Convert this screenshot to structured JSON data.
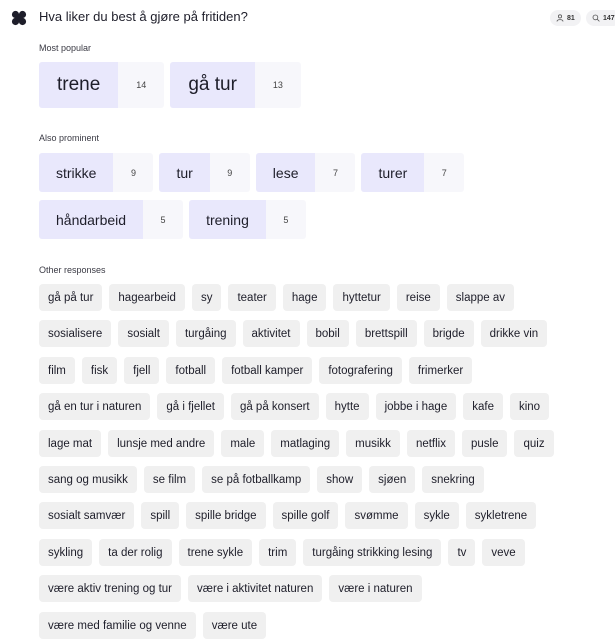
{
  "header": {
    "question": "Hva liker du best å gjøre på fritiden?",
    "participants_count": "81",
    "responses_count": "147"
  },
  "sections": {
    "most_popular": {
      "label": "Most popular",
      "items": [
        {
          "label": "trene",
          "count": "14"
        },
        {
          "label": "gå tur",
          "count": "13"
        }
      ]
    },
    "also_prominent": {
      "label": "Also prominent",
      "rows": [
        [
          {
            "label": "strikke",
            "count": "9"
          },
          {
            "label": "tur",
            "count": "9"
          },
          {
            "label": "lese",
            "count": "7"
          },
          {
            "label": "turer",
            "count": "7"
          }
        ],
        [
          {
            "label": "håndarbeid",
            "count": "5"
          },
          {
            "label": "trening",
            "count": "5"
          }
        ]
      ]
    },
    "other": {
      "label": "Other responses",
      "rows": [
        [
          "gå på tur",
          "hagearbeid",
          "sy",
          "teater",
          "hage",
          "hyttetur",
          "reise",
          "slappe av"
        ],
        [
          "sosialisere",
          "sosialt",
          "turgåing",
          "aktivitet",
          "bobil",
          "brettspill",
          "brigde",
          "drikke vin"
        ],
        [
          "film",
          "fisk",
          "fjell",
          "fotball",
          "fotball kamper",
          "fotografering",
          "frimerker"
        ],
        [
          "gå en tur i naturen",
          "gå i fjellet",
          "gå på konsert",
          "hytte",
          "jobbe i hage",
          "kafe",
          "kino"
        ],
        [
          "lage mat",
          "lunsje med andre",
          "male",
          "matlaging",
          "musikk",
          "netflix",
          "pusle",
          "quiz"
        ],
        [
          "sang og musikk",
          "se film",
          "se på fotballkamp",
          "show",
          "sjøen",
          "snekring"
        ],
        [
          "sosialt samvær",
          "spill",
          "spille bridge",
          "spille golf",
          "svømme",
          "sykle",
          "sykletrene"
        ],
        [
          "sykling",
          "ta der rolig",
          "trene sykle",
          "trim",
          "turgåing strikking lesing",
          "tv",
          "veve"
        ],
        [
          "være aktiv trening og tur",
          "være i aktivitet naturen",
          "være i naturen"
        ],
        [
          "være med familie og venne",
          "være ute"
        ]
      ]
    }
  },
  "colors": {
    "accent_chip": "#e9e8fc",
    "count_bg": "#f7f7fb",
    "tag_bg": "#f0f0f0"
  },
  "icons": {
    "logo": "clover-logo-icon",
    "participants": "person-icon",
    "responses": "search-icon"
  }
}
